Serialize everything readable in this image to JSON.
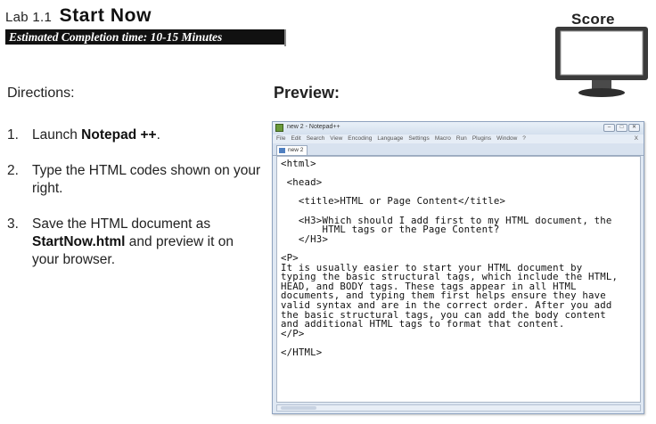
{
  "header": {
    "lab_number": "Lab 1.1",
    "lab_title": "Start Now",
    "estimated_time": "Estimated Completion time: 10-15 Minutes"
  },
  "score": {
    "label": "Score",
    "icon": "monitor-icon"
  },
  "directions": {
    "label": "Directions:",
    "steps": [
      {
        "num": "1.",
        "text_a": "Launch ",
        "bold_a": "Notepad ++",
        "text_b": "."
      },
      {
        "num": "2.",
        "text_a": "Type the HTML codes shown on your right."
      },
      {
        "num": "3.",
        "text_a": "Save the HTML document as ",
        "bold_a": "StartNow.html",
        "text_b": " and preview it on your browser."
      }
    ]
  },
  "preview": {
    "label": "Preview:",
    "window": {
      "title": "new 2 - Notepad++",
      "controls": [
        "–",
        "□",
        "✕"
      ],
      "menus": [
        "File",
        "Edit",
        "Search",
        "View",
        "Encoding",
        "Language",
        "Settings",
        "Macro",
        "Run",
        "Plugins",
        "Window",
        "?"
      ],
      "menu_close": "X",
      "tab": "new 2",
      "code": "<html>\n\n <head>\n\n   <title>HTML or Page Content</title>\n\n   <H3>Which should I add first to my HTML document, the\n       HTML tags or the Page Content?\n   </H3>\n\n<P>\nIt is usually easier to start your HTML document by\ntyping the basic structural tags, which include the HTML,\nHEAD, and BODY tags. These tags appear in all HTML\ndocuments, and typing them first helps ensure they have\nvalid syntax and are in the correct order. After you add\nthe basic structural tags, you can add the body content\nand additional HTML tags to format that content.\n</P>\n\n</HTML>"
    }
  },
  "colors": {
    "title_bar_bg": "#111111",
    "window_frame": "#dfe8f3",
    "monitor_screen": "#ffffff"
  }
}
